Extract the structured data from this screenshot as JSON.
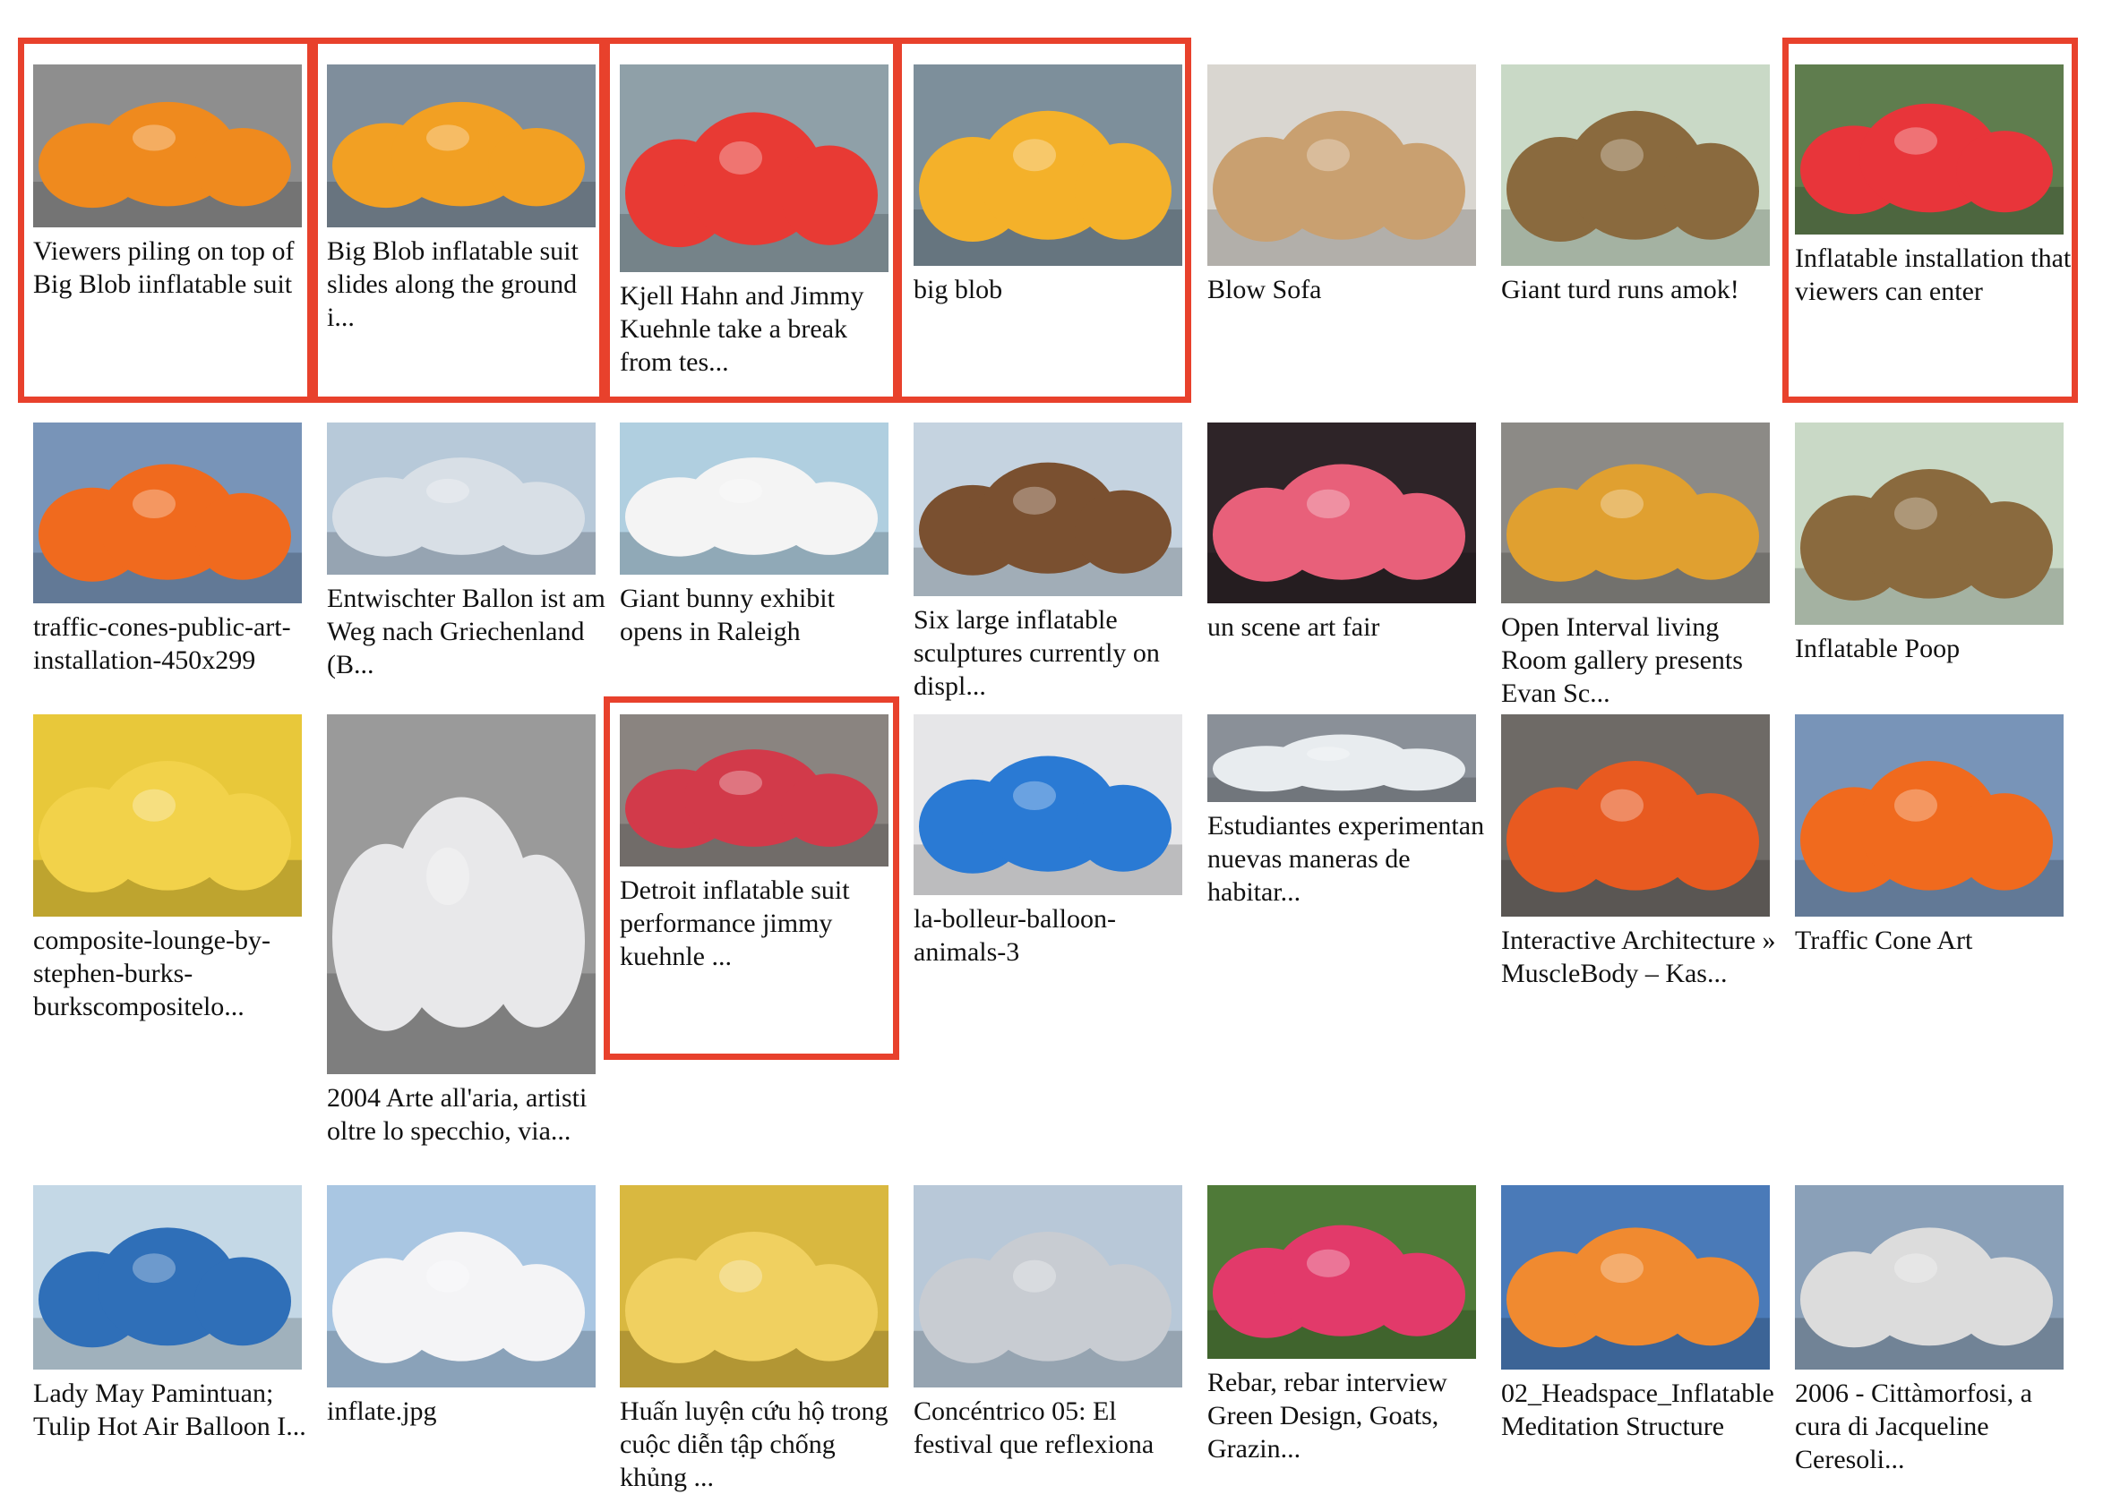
{
  "accent": "#e8412c",
  "items": [
    {
      "caption": "Viewers piling on top of Big Blob iinflatable suit",
      "selected": true,
      "bg": "#8e8e8e",
      "fg": "#ef8a1e",
      "icon": "orange-blob-image"
    },
    {
      "caption": "Big Blob inflatable suit slides along the ground i...",
      "selected": true,
      "bg": "#7f8e9c",
      "fg": "#f2a023",
      "icon": "orange-blob-image"
    },
    {
      "caption": "Kjell Hahn and Jimmy Kuehnle take a break from tes...",
      "selected": true,
      "bg": "#8fa0a8",
      "fg": "#e83a34",
      "icon": "red-inflatable-image"
    },
    {
      "caption": "big blob",
      "selected": true,
      "bg": "#7d8f9b",
      "fg": "#f4b12a",
      "icon": "orange-blob-image"
    },
    {
      "caption": "Blow Sofa",
      "selected": false,
      "bg": "#d9d6d0",
      "fg": "#c9a070",
      "icon": "sofa-image"
    },
    {
      "caption": "Giant turd runs amok!",
      "selected": false,
      "bg": "#c9d9c6",
      "fg": "#8a6a3e",
      "icon": "brown-sculpture-image"
    },
    {
      "caption": "Inflatable installation that viewers can enter",
      "selected": true,
      "bg": "#5f7d4e",
      "fg": "#e8353a",
      "icon": "red-inflatable-image"
    },
    {
      "caption": "traffic-cones-public-art-installation-450x299",
      "selected": false,
      "bg": "#7894b8",
      "fg": "#f06a1e",
      "icon": "cone-sculpture-image"
    },
    {
      "caption": "Entwischter Ballon ist am Weg nach Griechenland (B...",
      "selected": false,
      "bg": "#b7c9d9",
      "fg": "#d8dfe6",
      "icon": "balloon-image"
    },
    {
      "caption": "Giant bunny exhibit opens in Raleigh",
      "selected": false,
      "bg": "#b0cfe0",
      "fg": "#f4f4f4",
      "icon": "bunny-image"
    },
    {
      "caption": "Six large inflatable sculptures currently on displ...",
      "selected": false,
      "bg": "#c5d3e0",
      "fg": "#7a5030",
      "icon": "brown-sculpture-image"
    },
    {
      "caption": "un scene art fair",
      "selected": false,
      "bg": "#2e2428",
      "fg": "#e8607a",
      "icon": "tunnel-image"
    },
    {
      "caption": "Open Interval living Room gallery presents Evan Sc...",
      "selected": false,
      "bg": "#8c8a86",
      "fg": "#e0a030",
      "icon": "gallery-image"
    },
    {
      "caption": "Inflatable Poop",
      "selected": false,
      "bg": "#c9d9c6",
      "fg": "#8a6a3e",
      "icon": "brown-sculpture-image"
    },
    {
      "caption": "composite-lounge-by-stephen-burks-burkscompositelo...",
      "selected": false,
      "bg": "#e8c83a",
      "fg": "#f2d24a",
      "icon": "yellow-lounge-image"
    },
    {
      "caption": "2004 Arte all'aria, artisti oltre lo specchio, via...",
      "selected": false,
      "bg": "#9a9a9a",
      "fg": "#e8e8ea",
      "icon": "white-cushion-image"
    },
    {
      "caption": "Detroit inflatable suit performance jimmy kuehnle ...",
      "selected": true,
      "bg": "#8a8480",
      "fg": "#d23a4a",
      "icon": "colorful-suit-image"
    },
    {
      "caption": "la-bolleur-balloon-animals-3",
      "selected": false,
      "bg": "#e6e6e8",
      "fg": "#2a7ad4",
      "icon": "balloon-dog-image"
    },
    {
      "caption": "Estudiantes experimentan nuevas maneras de habitar...",
      "selected": false,
      "bg": "#8a9098",
      "fg": "#e8ecef",
      "icon": "dome-image"
    },
    {
      "caption": "Interactive Architecture » MuscleBody – Kas...",
      "selected": false,
      "bg": "#6e6a66",
      "fg": "#e85a20",
      "icon": "muscle-body-image"
    },
    {
      "caption": "Traffic Cone Art",
      "selected": false,
      "bg": "#7894b8",
      "fg": "#f06a1e",
      "icon": "cone-sculpture-image"
    },
    {
      "caption": "Lady May Pamintuan; Tulip Hot Air Balloon I...",
      "selected": false,
      "bg": "#c4d8e6",
      "fg": "#2f6fb8",
      "icon": "tulip-balloon-image"
    },
    {
      "caption": "inflate.jpg",
      "selected": false,
      "bg": "#a9c6e2",
      "fg": "#f4f4f6",
      "icon": "white-inflatable-image"
    },
    {
      "caption": "Huấn luyện cứu hộ trong cuộc diễn tập chống khủng ...",
      "selected": false,
      "bg": "#d9b840",
      "fg": "#f0d060",
      "icon": "yellow-inflatable-image"
    },
    {
      "caption": "Concéntrico 05: El festival que reflexiona sobr...",
      "selected": false,
      "bg": "#b8c8d8",
      "fg": "#c8ccd2",
      "icon": "silver-cubes-image"
    },
    {
      "caption": "Rebar, rebar interview Green Design, Goats, Grazin...",
      "selected": false,
      "bg": "#4f7a38",
      "fg": "#e23a6a",
      "icon": "pink-inflatable-image"
    },
    {
      "caption": "02_Headspace_Inflatable Meditation Structure",
      "selected": false,
      "bg": "#4a7ab8",
      "fg": "#f08a30",
      "icon": "headspace-image"
    },
    {
      "caption": "2006 - Cittàmorfosi, a cura di Jacqueline Ceresoli...",
      "selected": false,
      "bg": "#8aa0b8",
      "fg": "#dcdcdc",
      "icon": "white-tube-image"
    }
  ]
}
